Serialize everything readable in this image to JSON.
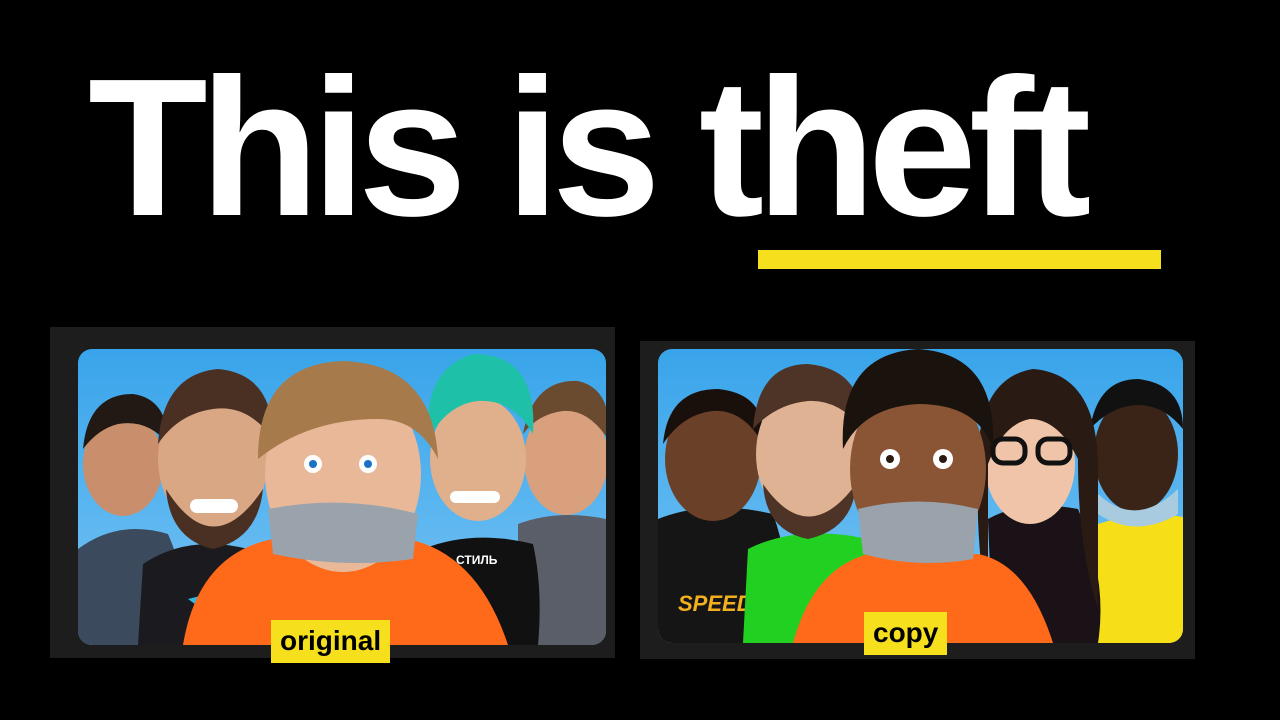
{
  "headline": {
    "prefix": "This is",
    "emphasis": "theft"
  },
  "accent_color": "#f6e01e",
  "thumbnails": {
    "original": {
      "label": "original",
      "shirt_text": "СТИЛЬ"
    },
    "copy": {
      "label": "copy",
      "shirt_text": "SPEED"
    }
  }
}
